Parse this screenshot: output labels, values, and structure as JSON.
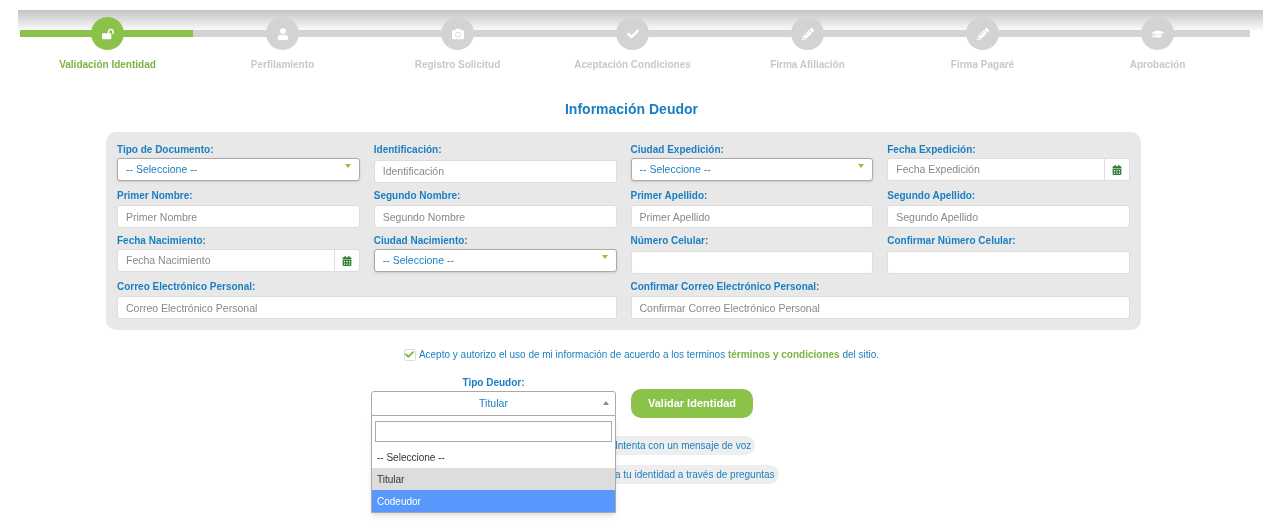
{
  "steps": [
    {
      "label": "Validación Identidad",
      "active": true
    },
    {
      "label": "Perfilamiento",
      "active": false
    },
    {
      "label": "Registro Solicitud",
      "active": false
    },
    {
      "label": "Aceptación Condiciones",
      "active": false
    },
    {
      "label": "Firma Afiliación",
      "active": false
    },
    {
      "label": "Firma Pagaré",
      "active": false
    },
    {
      "label": "Aprobación",
      "active": false
    }
  ],
  "title": "Información Deudor",
  "fields": [
    {
      "label": "Tipo de Documento:",
      "kind": "select",
      "value": "-- Seleccione --",
      "wide": false
    },
    {
      "label": "Identificación:",
      "kind": "text",
      "placeholder": "Identificación",
      "wide": false
    },
    {
      "label": "Ciudad Expedición:",
      "kind": "select",
      "value": "-- Seleccione --",
      "wide": false
    },
    {
      "label": "Fecha Expedición:",
      "kind": "date",
      "placeholder": "Fecha Expedición",
      "wide": false
    },
    {
      "label": "Primer Nombre:",
      "kind": "text",
      "placeholder": "Primer Nombre",
      "wide": false
    },
    {
      "label": "Segundo Nombre:",
      "kind": "text",
      "placeholder": "Segundo Nombre",
      "wide": false
    },
    {
      "label": "Primer Apellido:",
      "kind": "text",
      "placeholder": "Primer Apellido",
      "wide": false
    },
    {
      "label": "Segundo Apellido:",
      "kind": "text",
      "placeholder": "Segundo Apellido",
      "wide": false
    },
    {
      "label": "Fecha Nacimiento:",
      "kind": "date",
      "placeholder": "Fecha Nacimiento",
      "wide": false
    },
    {
      "label": "Ciudad Nacimiento:",
      "kind": "select",
      "value": "-- Seleccione --",
      "wide": false
    },
    {
      "label": "Número Celular:",
      "kind": "text",
      "wide": false
    },
    {
      "label": "Confirmar Número Celular:",
      "kind": "text",
      "wide": false
    },
    {
      "label": "Correo Electrónico Personal:",
      "kind": "text",
      "placeholder": "Correo Electrónico Personal",
      "wide": true
    },
    {
      "label": "Confirmar Correo Electrónico Personal:",
      "kind": "text",
      "placeholder": "Confirmar Correo Electrónico Personal",
      "wide": true
    }
  ],
  "consent": {
    "checked": true,
    "text": "Acepto y autorizo el uso de mi información de acuerdo a los terminos",
    "link": "términos y condiciones",
    "suffix": "del sitio."
  },
  "debtor_type": {
    "label": "Tipo Deudor:",
    "value": "Titular",
    "expanded": true,
    "options": [
      {
        "label": "-- Seleccione --",
        "selected": false,
        "highlighted": false
      },
      {
        "label": "Titular",
        "selected": true,
        "highlighted": false
      },
      {
        "label": "Codeudor",
        "selected": false,
        "highlighted": true
      }
    ]
  },
  "validate_button": "Validar Identidad",
  "links": [
    "Intenta con un mensaje de voz",
    "a tu identidad a través de preguntas"
  ]
}
